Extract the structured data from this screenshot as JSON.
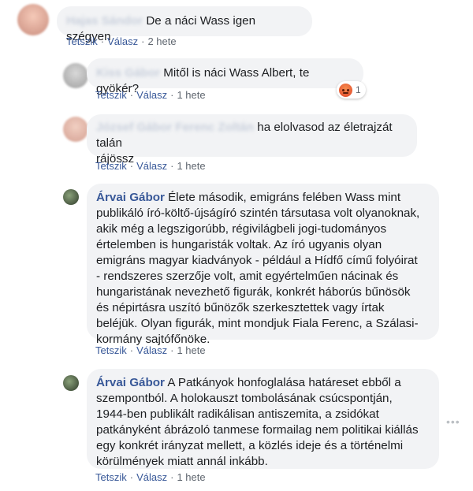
{
  "comments": [
    {
      "author": "Hajas Sándor",
      "text": "De a náci Wass igen szégyen",
      "actions": {
        "like": "Tetszik",
        "reply": "Válasz",
        "time": "2 hete"
      }
    },
    {
      "author": "Kiss Gábor",
      "text": "Mitől is náci Wass Albert, te gyökér?",
      "reaction": {
        "count": "1"
      },
      "actions": {
        "like": "Tetszik",
        "reply": "Válasz",
        "time": "1 hete"
      }
    },
    {
      "author": "József Gábor Ferenc Zoltán",
      "text_line1": "ha elolvasod az életrajzát talán",
      "text_line2": "rájössz",
      "actions": {
        "like": "Tetszik",
        "reply": "Válasz",
        "time": "1 hete"
      }
    },
    {
      "author": "Árvai Gábor",
      "lines": [
        "Élete második, emigráns felében Wass mint",
        "publikáló író-költő-újságíró szintén társutasa volt olyanoknak,",
        "akik még a legszigorúbb, régivilágbeli jogi-tudományos",
        "értelemben is hungaristák voltak. Az író ugyanis olyan",
        "emigráns magyar kiadványok - például a Hídfő című folyóirat",
        "- rendszeres szerzője volt, amit egyértelműen nácinak és",
        "hungaristának nevezhető figurák, konkrét háborús bűnösök",
        "és népirtásra uszító bűnözők szerkesztettek vagy írtak",
        "beléjük. Olyan figurák, mint mondjuk Fiala Ferenc, a Szálasi-",
        "kormány sajtófőnöke."
      ],
      "actions": {
        "like": "Tetszik",
        "reply": "Válasz",
        "time": "1 hete"
      }
    },
    {
      "author": "Árvai Gábor",
      "lines": [
        "A Patkányok honfoglalása határeset ebből a",
        "szempontból. A holokauszt tombolásának csúcspontján,",
        "1944-ben publikált radikálisan antiszemita, a zsidókat",
        "patkányként ábrázoló tanmese formailag nem politikai kiállás",
        "egy konkrét irányzat mellett, a közlés ideje és a történelmi",
        "körülmények miatt annál inkább."
      ],
      "more_icon": "more-options-icon",
      "actions": {
        "like": "Tetszik",
        "reply": "Válasz",
        "time": "1 hete"
      }
    }
  ]
}
